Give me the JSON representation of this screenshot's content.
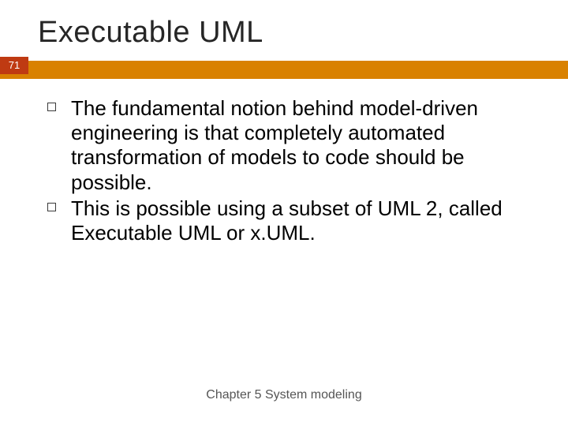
{
  "slide": {
    "title": "Executable UML",
    "page_number": "71",
    "bullets": [
      "The fundamental notion behind model-driven engineering is that completely automated transformation of models to code should be possible.",
      "This is possible using a subset of UML 2, called Executable UML or x.UML."
    ],
    "footer": "Chapter 5 System modeling"
  },
  "colors": {
    "accent_bar": "#d98100",
    "page_badge": "#bf3a12"
  }
}
